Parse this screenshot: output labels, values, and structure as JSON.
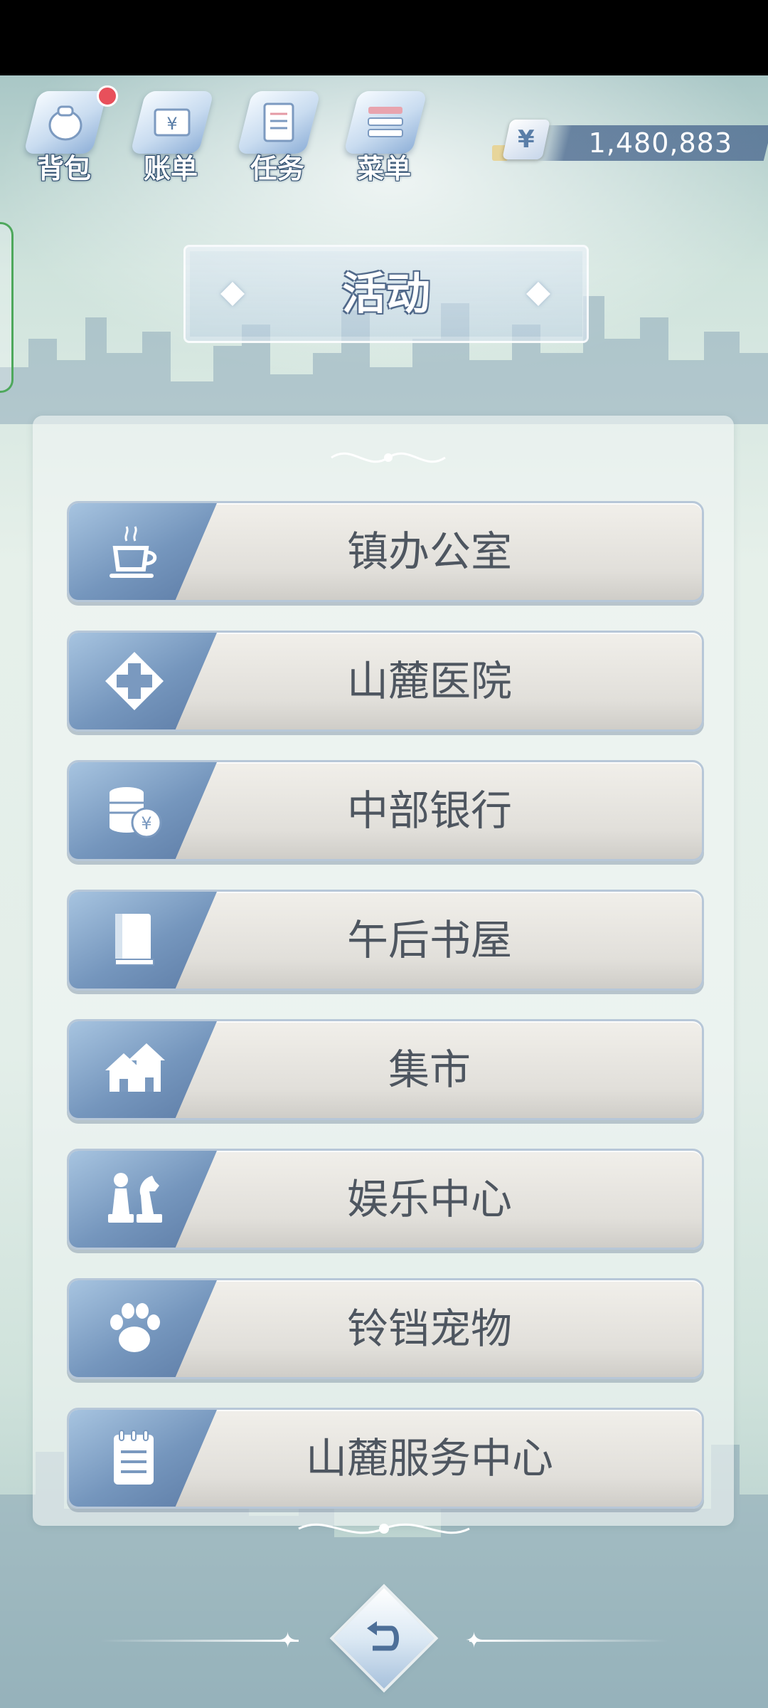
{
  "top_bar": {
    "items": [
      {
        "label": "背包",
        "icon": "backpack-icon",
        "badge": true
      },
      {
        "label": "账单",
        "icon": "bill-icon",
        "badge": false
      },
      {
        "label": "任务",
        "icon": "task-icon",
        "badge": false
      },
      {
        "label": "菜单",
        "icon": "menu-icon",
        "badge": false
      }
    ],
    "currency_symbol": "¥",
    "money": "1,480,883"
  },
  "title": "活动",
  "menu": {
    "items": [
      {
        "label": "镇办公室",
        "icon": "coffee-cup-icon"
      },
      {
        "label": "山麓医院",
        "icon": "hospital-cross-icon"
      },
      {
        "label": "中部银行",
        "icon": "coin-stack-yen-icon"
      },
      {
        "label": "午后书屋",
        "icon": "book-icon"
      },
      {
        "label": "集市",
        "icon": "houses-icon"
      },
      {
        "label": "娱乐中心",
        "icon": "chess-pieces-icon"
      },
      {
        "label": "铃铛宠物",
        "icon": "paw-icon"
      },
      {
        "label": "山麓服务中心",
        "icon": "notepad-icon"
      }
    ]
  },
  "back_button": {
    "icon": "back-arrow-icon"
  },
  "colors": {
    "accent_blue": "#7596bd",
    "row_bg": "#e6e4df",
    "text": "#4e5660",
    "badge": "#e8505b"
  }
}
